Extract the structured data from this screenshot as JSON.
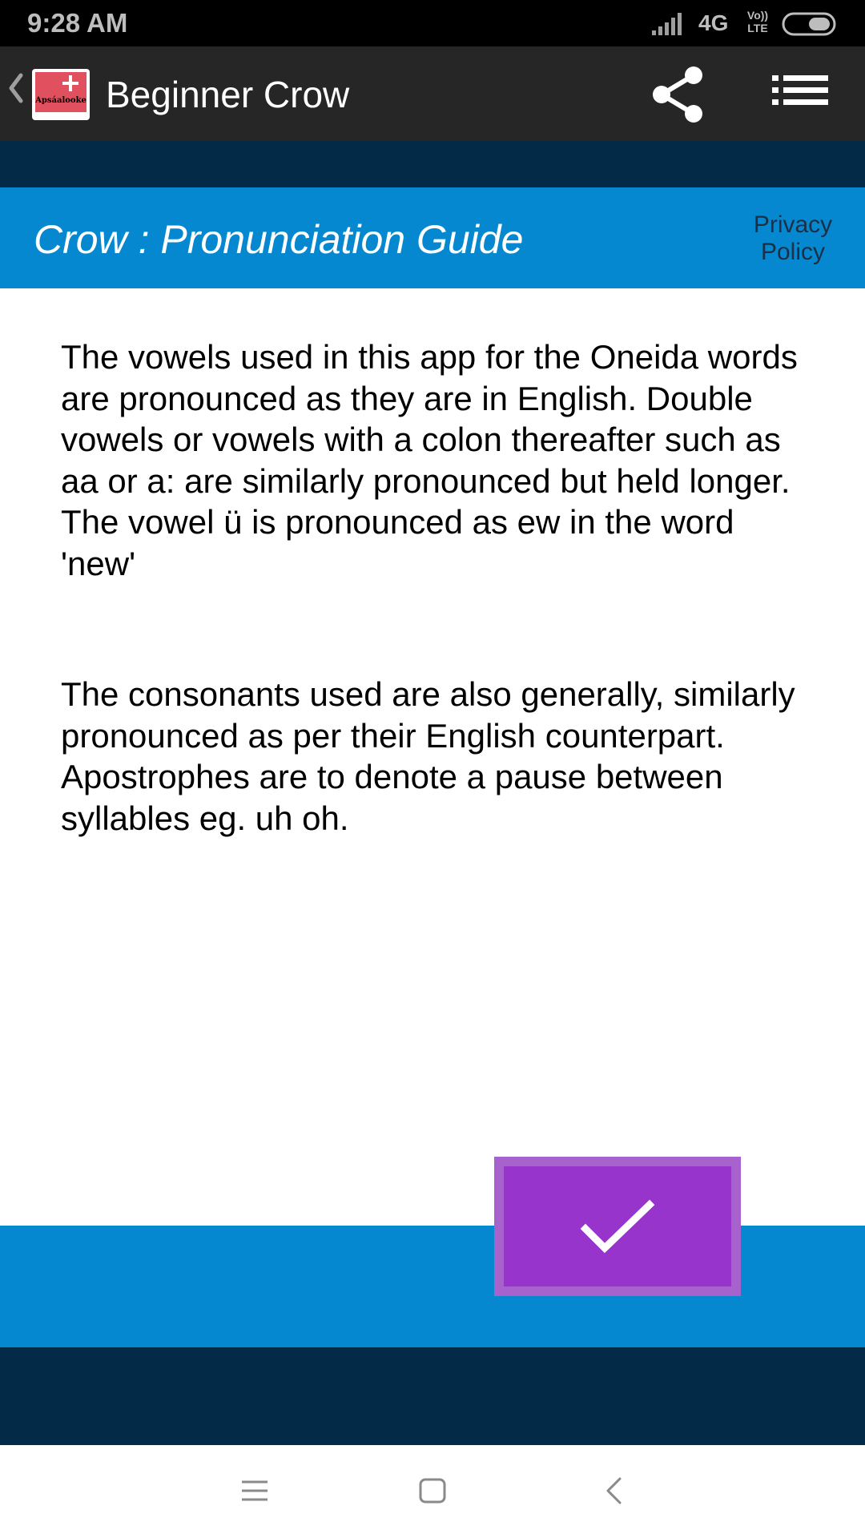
{
  "status_bar": {
    "time": "9:28 AM",
    "network": "4G",
    "volte_line1": "Vo))",
    "volte_line2": "LTE"
  },
  "app_bar": {
    "title": "Beginner Crow",
    "logo_text": "Apsáalooke",
    "icons": [
      "back-chevron-icon",
      "share-icon",
      "menu-list-icon"
    ]
  },
  "header": {
    "title": "Crow : Pronunciation Guide",
    "privacy_line1": "Privacy",
    "privacy_line2": "Policy"
  },
  "content": {
    "paragraph_1": "The vowels used in this app for the Oneida words are pronounced as they are in English. Double vowels or vowels with a colon thereafter such as aa or a: are similarly pronounced but held longer. The vowel ü is pronounced as ew in the word 'new'",
    "paragraph_2": "The consonants used are also generally, similarly pronounced as per their English counterpart. Apostrophes are to denote a pause between syllables eg. uh oh."
  },
  "confirm_button": {
    "icon": "checkmark-icon"
  },
  "colors": {
    "status_bar": "#000000",
    "app_bar": "#262626",
    "navy": "#032a47",
    "blue": "#0588d0",
    "button_outer": "#a862ce",
    "button_inner": "#9734cc"
  },
  "nav_bar": {
    "icons": [
      "recent-apps-icon",
      "home-icon",
      "back-icon"
    ]
  }
}
